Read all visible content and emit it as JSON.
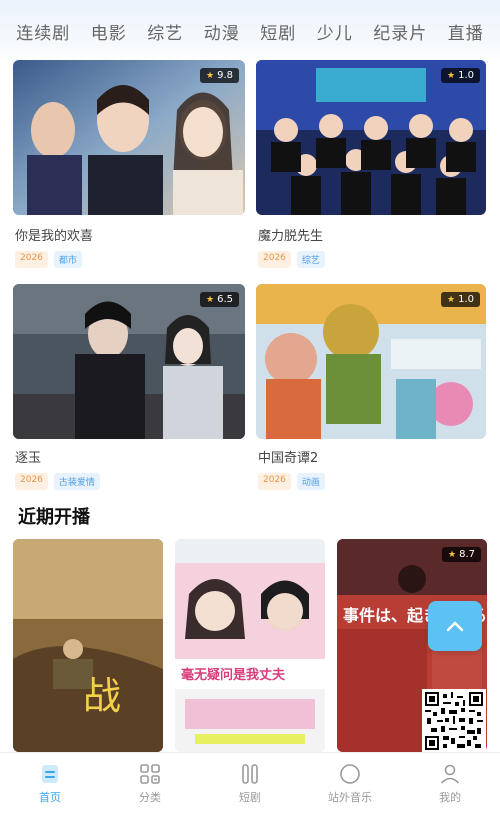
{
  "top_nav": {
    "tabs": [
      "连续剧",
      "电影",
      "综艺",
      "动漫",
      "短剧",
      "少儿",
      "纪录片",
      "直播"
    ]
  },
  "cards": [
    {
      "title": "你是我的欢喜",
      "score": "9.8",
      "year": "2026",
      "genre": "都市"
    },
    {
      "title": "魔力脱先生",
      "score": "1.0",
      "year": "2026",
      "genre": "综艺"
    },
    {
      "title": "逐玉",
      "score": "6.5",
      "year": "2026",
      "genre": "古装爱情"
    },
    {
      "title": "中国奇谭2",
      "score": "1.0",
      "year": "2026",
      "genre": "动画"
    }
  ],
  "upcoming": {
    "section_title": "近期开播",
    "items": [
      {
        "poster_text": "战"
      },
      {
        "poster_text": "毫无疑问是我丈夫"
      },
      {
        "poster_text": "事件は、起きている",
        "score": "8.7"
      }
    ]
  },
  "bottom_tabs": [
    {
      "label": "首页",
      "icon": "home-icon",
      "active": true
    },
    {
      "label": "分类",
      "icon": "category-icon",
      "active": false
    },
    {
      "label": "短剧",
      "icon": "short-drama-icon",
      "active": false
    },
    {
      "label": "站外音乐",
      "icon": "music-icon",
      "active": false
    },
    {
      "label": "我的",
      "icon": "profile-icon",
      "active": false
    }
  ],
  "colors": {
    "accent": "#3aa6f0",
    "scroll_button": "#5bc2f3"
  }
}
